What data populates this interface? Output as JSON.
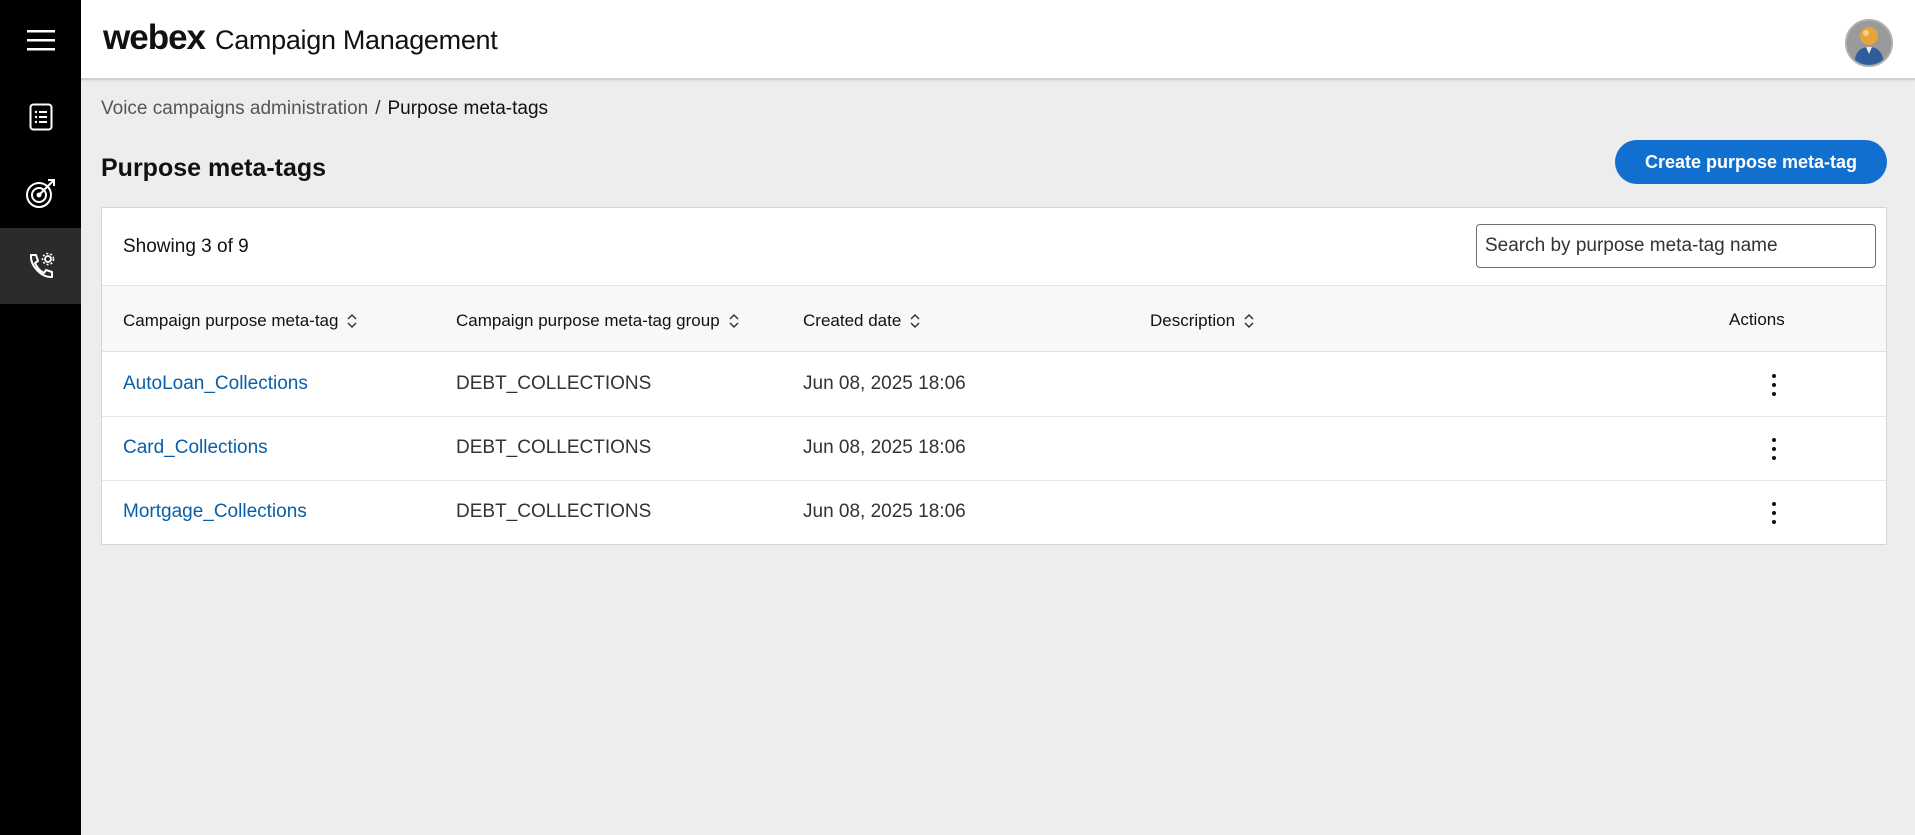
{
  "header": {
    "brand_logo": "webex",
    "brand_title": "Campaign Management"
  },
  "sidebar": {
    "items": [
      {
        "icon": "hamburger-menu-icon"
      },
      {
        "icon": "list-document-icon"
      },
      {
        "icon": "target-icon"
      },
      {
        "icon": "phone-settings-icon",
        "active": true
      }
    ]
  },
  "breadcrumb": {
    "parent": "Voice campaigns administration",
    "separator": "/",
    "current": "Purpose meta-tags"
  },
  "page": {
    "title": "Purpose meta-tags",
    "create_button": "Create purpose meta-tag"
  },
  "table": {
    "showing": "Showing 3 of 9",
    "search_placeholder": "Search by purpose meta-tag name",
    "columns": [
      "Campaign purpose meta-tag",
      "Campaign purpose meta-tag group",
      "Created date",
      "Description",
      "Actions"
    ],
    "rows": [
      {
        "name": "AutoLoan_Collections",
        "group": "DEBT_COLLECTIONS",
        "created": "Jun 08, 2025 18:06",
        "description": ""
      },
      {
        "name": "Card_Collections",
        "group": "DEBT_COLLECTIONS",
        "created": "Jun 08, 2025 18:06",
        "description": ""
      },
      {
        "name": "Mortgage_Collections",
        "group": "DEBT_COLLECTIONS",
        "created": "Jun 08, 2025 18:06",
        "description": ""
      }
    ]
  },
  "colors": {
    "primary": "#1170cf",
    "link": "#0a5ea8",
    "sidebar_bg": "#000000",
    "page_bg": "#ededed"
  }
}
